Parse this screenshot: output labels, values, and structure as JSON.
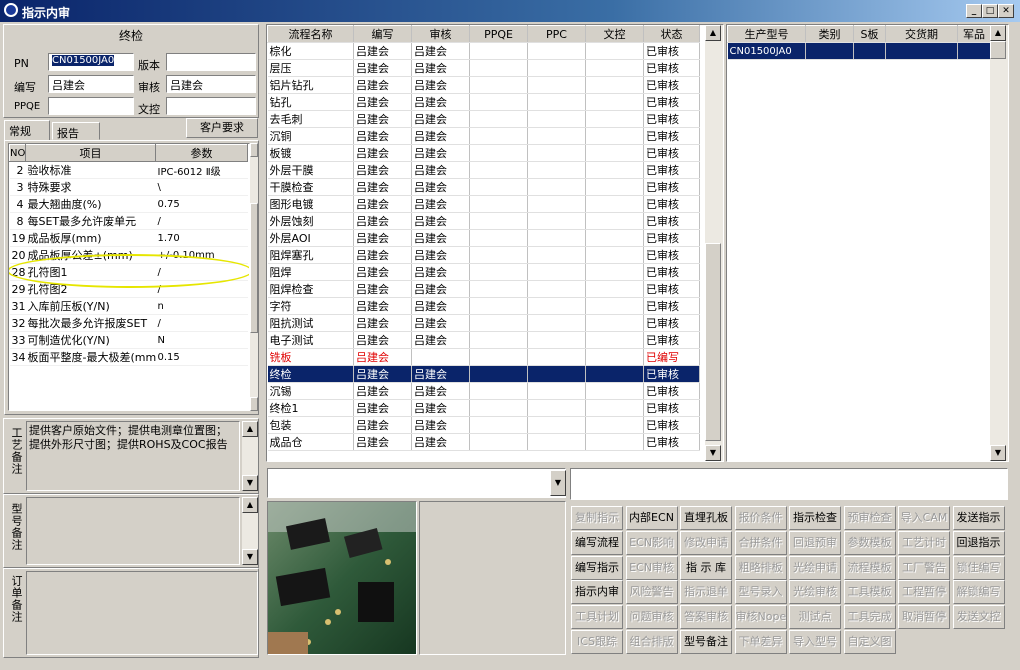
{
  "window": {
    "title": "指示内审"
  },
  "final": {
    "group_title": "终检",
    "pn_label": "PN",
    "pn_value": "CN01500JA0",
    "version_label": "版本",
    "version_value": "",
    "author_label": "编写",
    "author_value": "吕建会",
    "review_label": "审核",
    "review_value": "吕建会",
    "ppqe_label": "PPQE",
    "ppqe_value": "",
    "doc_label": "文控",
    "doc_value": ""
  },
  "tabs": {
    "general": "常规",
    "report": "报告",
    "customer_req": "客户要求"
  },
  "params": {
    "headers": [
      "NO",
      "项目",
      "参数"
    ],
    "rows": [
      [
        "2",
        "验收标准",
        "IPC-6012 Ⅱ级"
      ],
      [
        "3",
        "特殊要求",
        "\\"
      ],
      [
        "4",
        "最大翘曲度(%)",
        "0.75"
      ],
      [
        "8",
        "每SET最多允许废单元",
        "/"
      ],
      [
        "19",
        "成品板厚(mm)",
        "1.70"
      ],
      [
        "20",
        "成品板厚公差±(mm)",
        "+/-0.10mm"
      ],
      [
        "28",
        "孔符图1",
        "/"
      ],
      [
        "29",
        "孔符图2",
        "/"
      ],
      [
        "31",
        "入库前压板(Y/N)",
        "n"
      ],
      [
        "32",
        "每批次最多允许报废SET",
        "/"
      ],
      [
        "33",
        "可制造优化(Y/N)",
        "N"
      ],
      [
        "34",
        "板面平整度-最大极差(mm)",
        "0.15"
      ]
    ]
  },
  "notes": {
    "work_label": "工艺备注",
    "work_text": "提供客户原始文件；提供电测章位置图；提供外形尺寸图；提供ROHS及COC报告",
    "model_label": "型号备注",
    "order_label": "订单备注"
  },
  "flow": {
    "headers": [
      "流程名称",
      "编写",
      "审核",
      "PPQE",
      "PPC",
      "文控",
      "状态"
    ],
    "rows": [
      [
        "棕化",
        "吕建会",
        "吕建会",
        "",
        "",
        "",
        "已审核"
      ],
      [
        "层压",
        "吕建会",
        "吕建会",
        "",
        "",
        "",
        "已审核"
      ],
      [
        "铝片钻孔",
        "吕建会",
        "吕建会",
        "",
        "",
        "",
        "已审核"
      ],
      [
        "钻孔",
        "吕建会",
        "吕建会",
        "",
        "",
        "",
        "已审核"
      ],
      [
        "去毛刺",
        "吕建会",
        "吕建会",
        "",
        "",
        "",
        "已审核"
      ],
      [
        "沉铜",
        "吕建会",
        "吕建会",
        "",
        "",
        "",
        "已审核"
      ],
      [
        "板镀",
        "吕建会",
        "吕建会",
        "",
        "",
        "",
        "已审核"
      ],
      [
        "外层干膜",
        "吕建会",
        "吕建会",
        "",
        "",
        "",
        "已审核"
      ],
      [
        "干膜检查",
        "吕建会",
        "吕建会",
        "",
        "",
        "",
        "已审核"
      ],
      [
        "图形电镀",
        "吕建会",
        "吕建会",
        "",
        "",
        "",
        "已审核"
      ],
      [
        "外层蚀刻",
        "吕建会",
        "吕建会",
        "",
        "",
        "",
        "已审核"
      ],
      [
        "外层AOI",
        "吕建会",
        "吕建会",
        "",
        "",
        "",
        "已审核"
      ],
      [
        "阻焊塞孔",
        "吕建会",
        "吕建会",
        "",
        "",
        "",
        "已审核"
      ],
      [
        "阻焊",
        "吕建会",
        "吕建会",
        "",
        "",
        "",
        "已审核"
      ],
      [
        "阻焊检查",
        "吕建会",
        "吕建会",
        "",
        "",
        "",
        "已审核"
      ],
      [
        "字符",
        "吕建会",
        "吕建会",
        "",
        "",
        "",
        "已审核"
      ],
      [
        "阻抗测试",
        "吕建会",
        "吕建会",
        "",
        "",
        "",
        "已审核"
      ],
      [
        "电子测试",
        "吕建会",
        "吕建会",
        "",
        "",
        "",
        "已审核"
      ],
      [
        "铣板",
        "吕建会",
        "",
        "",
        "",
        "",
        "已编写"
      ],
      [
        "终检",
        "吕建会",
        "吕建会",
        "",
        "",
        "",
        "已审核"
      ],
      [
        "沉锡",
        "吕建会",
        "吕建会",
        "",
        "",
        "",
        "已审核"
      ],
      [
        "终检1",
        "吕建会",
        "吕建会",
        "",
        "",
        "",
        "已审核"
      ],
      [
        "包装",
        "吕建会",
        "吕建会",
        "",
        "",
        "",
        "已审核"
      ],
      [
        "成品仓",
        "吕建会",
        "吕建会",
        "",
        "",
        "",
        "已审核"
      ]
    ],
    "selected_index": 19,
    "red_index": 18
  },
  "models": {
    "headers": [
      "生产型号",
      "类别",
      "S板",
      "交货期",
      "军品"
    ],
    "rows": [
      [
        "CN01500JA0",
        "",
        "",
        "",
        ""
      ]
    ]
  },
  "commands": [
    [
      "复制指示",
      "内部ECN",
      "直埋孔板",
      "报价条件",
      "指示检查",
      "预审检查",
      "导入CAM",
      "发送指示"
    ],
    [
      "编写流程",
      "ECN影响",
      "修改申请",
      "合拼条件",
      "回退预审",
      "参数模板",
      "工艺计时",
      "回退指示"
    ],
    [
      "编写指示",
      "ECN审核",
      "指 示 库",
      "粗略排板",
      "光绘申请",
      "流程模板",
      "工厂警告",
      "锁住编写"
    ],
    [
      "指示内审",
      "风险警告",
      "指示退单",
      "型号录入",
      "光绘审核",
      "工具模板",
      "工程暂停",
      "解锁编写"
    ],
    [
      "工具计划",
      "问题审核",
      "答案审核",
      "审核Nope",
      "测试点",
      "工具完成",
      "取消暂停",
      "发送文控"
    ],
    [
      "ICS跟踪",
      "组合排版",
      "型号备注",
      "下单差异",
      "导入型号",
      "自定义图",
      "",
      ""
    ]
  ],
  "enabled_commands": [
    "内部ECN",
    "直埋孔板",
    "指示检查",
    "发送指示",
    "编写流程",
    "回退指示",
    "编写指示",
    "指 示 库",
    "指示内审",
    "型号备注"
  ]
}
